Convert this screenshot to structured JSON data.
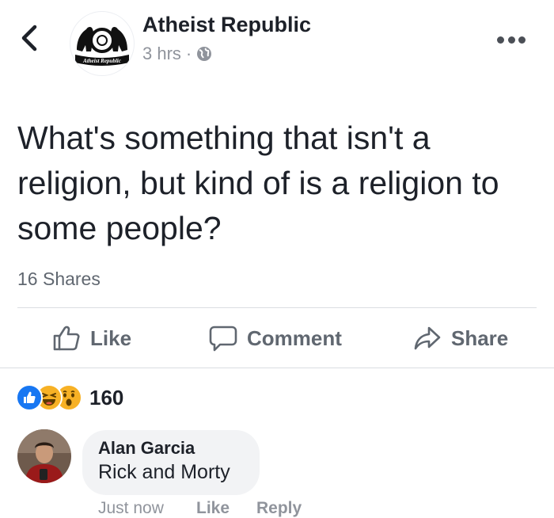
{
  "header": {
    "page_name": "Atheist Republic",
    "time": "3 hrs",
    "separator": "·",
    "privacy_icon": "globe-icon",
    "back_icon": "chevron-left-icon",
    "more_icon": "ellipsis-icon",
    "logo_text": "Atheist Republic"
  },
  "post": {
    "text": "What's something that isn't a religion, but kind of is a religion to some people?",
    "shares": "16 Shares"
  },
  "actions": {
    "like": "Like",
    "comment": "Comment",
    "share": "Share"
  },
  "reactions": {
    "icons": [
      "like-reaction-icon",
      "haha-reaction-icon",
      "wow-reaction-icon"
    ],
    "count": "160"
  },
  "comment": {
    "author": "Alan Garcia",
    "text": "Rick and Morty",
    "time": "Just now",
    "like": "Like",
    "reply": "Reply"
  },
  "colors": {
    "text": "#1d2129",
    "secondary": "#606770",
    "muted": "#90949c",
    "like_blue": "#1877f2",
    "haha_yellow": "#f7b125",
    "bubble": "#f2f3f5"
  }
}
